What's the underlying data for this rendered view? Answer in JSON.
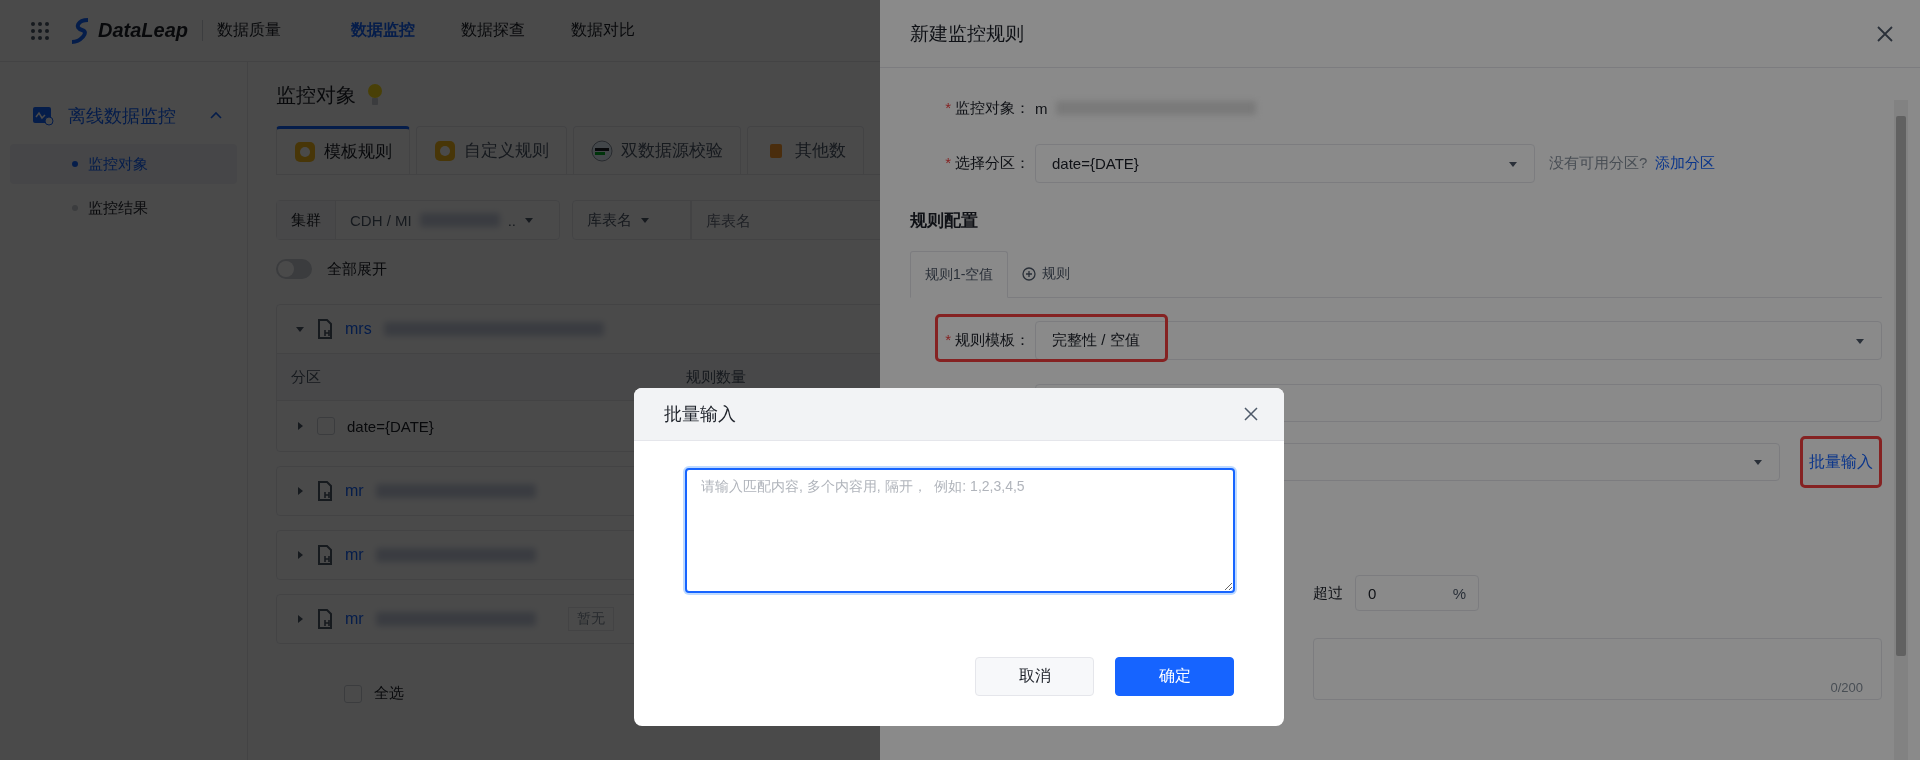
{
  "nav": {
    "brand": "DataLeap",
    "product": "数据质量",
    "tabs": [
      {
        "label": "数据监控",
        "selected": true
      },
      {
        "label": "数据探查",
        "selected": false
      },
      {
        "label": "数据对比",
        "selected": false
      }
    ]
  },
  "sidebar": {
    "group": {
      "label": "离线数据监控",
      "expanded": true
    },
    "items": [
      {
        "label": "监控对象",
        "selected": true
      },
      {
        "label": "监控结果",
        "selected": false
      }
    ]
  },
  "main": {
    "title": "监控对象",
    "tabs": [
      {
        "label": "模板规则",
        "selected": true
      },
      {
        "label": "自定义规则",
        "selected": false
      },
      {
        "label": "双数据源校验",
        "selected": false
      },
      {
        "label": "其他数",
        "selected": false
      }
    ],
    "filters": {
      "cluster_label": "集群",
      "cluster_value": "CDH / MI",
      "cluster_suffix": "..",
      "table_select": "库表名",
      "table_placeholder": "库表名"
    },
    "expand_all": {
      "label": "全部展开",
      "on": false
    },
    "tables": [
      {
        "name": "mrs",
        "expanded": true,
        "columns": [
          "分区",
          "规则数量"
        ],
        "rows": [
          {
            "partition": "date={DATE}",
            "checked": false
          }
        ]
      },
      {
        "name": "mr",
        "expanded": false
      },
      {
        "name": "mr",
        "expanded": false
      },
      {
        "name": "mr",
        "expanded": false,
        "tag": "暂无"
      }
    ],
    "select_all": {
      "label": "全选",
      "checked": false
    }
  },
  "drawer": {
    "title": "新建监控规则",
    "target": {
      "mark": "*",
      "label": "监控对象：",
      "value": "m"
    },
    "partition": {
      "mark": "*",
      "label": "选择分区：",
      "value": "date={DATE}",
      "hint": "没有可用分区?",
      "link": "添加分区"
    },
    "section": "规则配置",
    "rule_tabs": [
      {
        "label": "规则1-空值",
        "selected": true
      }
    ],
    "add_rule": "规则",
    "template": {
      "mark": "*",
      "label": "规则模板：",
      "value": "完整性 / 空值",
      "highlighted": true
    },
    "batch_link": {
      "label": "批量输入",
      "highlighted": true
    },
    "threshold": {
      "label": "超过",
      "value": "0",
      "unit": "%"
    },
    "note": {
      "counter": "0/200"
    }
  },
  "dialog": {
    "title": "批量输入",
    "placeholder": "请输入匹配内容, 多个内容用, 隔开，  例如: 1,2,3,4,5",
    "buttons": [
      {
        "label": "取消",
        "kind": "secondary"
      },
      {
        "label": "确定",
        "kind": "primary"
      }
    ]
  }
}
